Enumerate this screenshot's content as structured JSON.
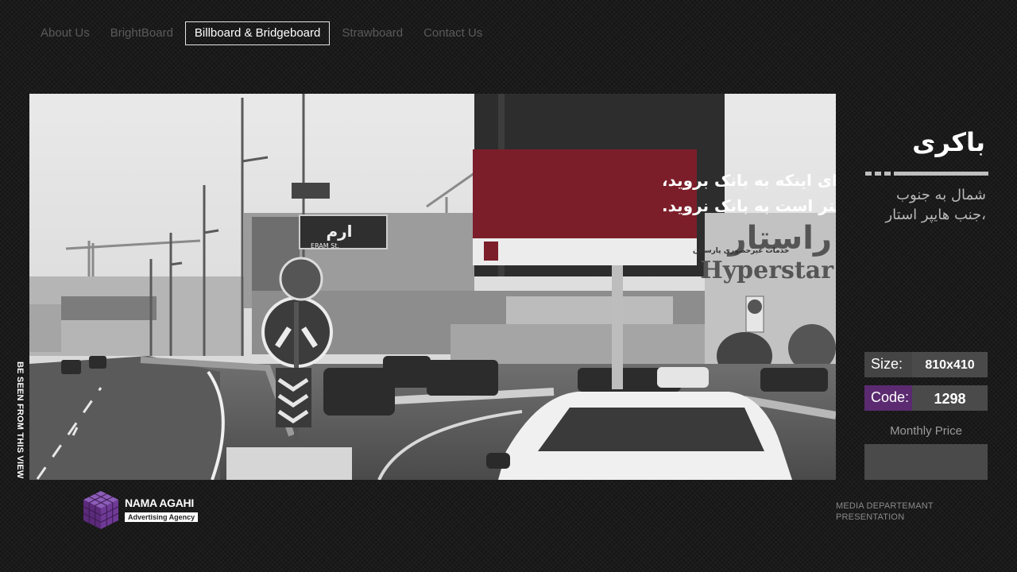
{
  "nav": {
    "items": [
      {
        "label": "About Us",
        "active": false
      },
      {
        "label": "BrightBoard",
        "active": false
      },
      {
        "label": "Billboard & Bridgeboard",
        "active": true
      },
      {
        "label": "Strawboard",
        "active": false
      },
      {
        "label": "Contact Us",
        "active": false
      }
    ]
  },
  "photo": {
    "side_caption": "BE SEEN FROM THIS VIEW",
    "billboard_line1": "برای اینکه به بانک بروید،",
    "billboard_line2": "بهتر است به بانک نروید.",
    "billboard_footer": "خدمات غیرحضوری پارسیان",
    "street_sign_fa": "ارم",
    "street_sign_en": "ERAM St.",
    "store_fa": "راستار",
    "store_en": "Hyperstar"
  },
  "panel": {
    "title": "باکری",
    "address_line1": "شمال به جنوب",
    "address_line2": "،جنب هایپر استار",
    "size_label": "Size:",
    "size_value": "810x410",
    "code_label": "Code:",
    "code_value": "1298",
    "monthly_price_label": "Monthly Price",
    "monthly_price_value": "",
    "accent_color": "#5b2a70"
  },
  "footer": {
    "logo_name": "NAMA AGAHI",
    "logo_tagline": "Advertising Agency",
    "dept_line1": "MEDIA DEPARTEMANT",
    "dept_line2": "PRESENTATION"
  }
}
